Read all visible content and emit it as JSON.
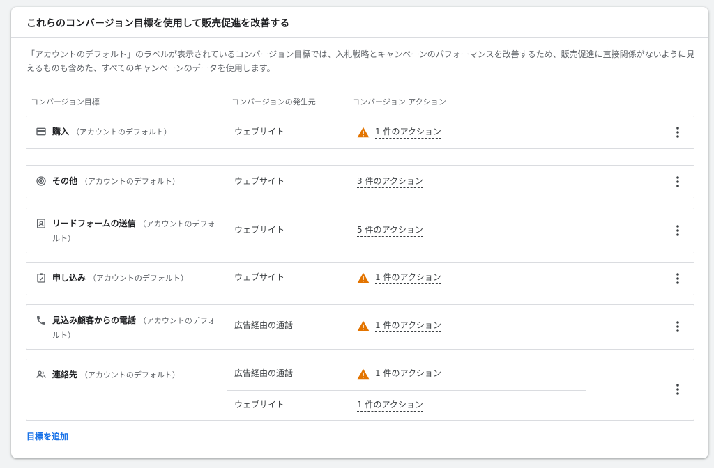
{
  "header": {
    "title": "これらのコンバージョン目標を使用して販売促進を改善する"
  },
  "description": "「アカウントのデフォルト」のラベルが表示されているコンバージョン目標では、入札戦略とキャンペーンのパフォーマンスを改善するため、販売促進に直接関係がないように見えるものも含めた、すべてのキャンペーンのデータを使用します。",
  "columns": {
    "goal": "コンバージョン目標",
    "source": "コンバージョンの発生元",
    "action": "コンバージョン アクション"
  },
  "rows": [
    {
      "icon": "credit-card-icon",
      "name": "購入",
      "default_label": "（アカウントのデフォルト）",
      "sources": [
        {
          "source": "ウェブサイト",
          "action": "1 件のアクション",
          "warning": true
        }
      ]
    },
    {
      "icon": "target-icon",
      "name": "その他",
      "default_label": "（アカウントのデフォルト）",
      "sources": [
        {
          "source": "ウェブサイト",
          "action": "3 件のアクション",
          "warning": false
        }
      ]
    },
    {
      "icon": "contact-form-icon",
      "name": "リードフォームの送信",
      "default_label": "（アカウントのデフォルト）",
      "sources": [
        {
          "source": "ウェブサイト",
          "action": "5 件のアクション",
          "warning": false
        }
      ]
    },
    {
      "icon": "clipboard-check-icon",
      "name": "申し込み",
      "default_label": "（アカウントのデフォルト）",
      "sources": [
        {
          "source": "ウェブサイト",
          "action": "1 件のアクション",
          "warning": true
        }
      ]
    },
    {
      "icon": "phone-icon",
      "name": "見込み顧客からの電話",
      "default_label": "（アカウントのデフォルト）",
      "sources": [
        {
          "source": "広告経由の通話",
          "action": "1 件のアクション",
          "warning": true
        }
      ]
    },
    {
      "icon": "people-icon",
      "name": "連絡先",
      "default_label": "（アカウントのデフォルト）",
      "sources": [
        {
          "source": "広告経由の通話",
          "action": "1 件のアクション",
          "warning": true
        },
        {
          "source": "ウェブサイト",
          "action": "1 件のアクション",
          "warning": false
        }
      ]
    }
  ],
  "add_goal_label": "目標を追加",
  "colors": {
    "accent": "#1a73e8",
    "warning": "#e37400",
    "border": "#dadce0",
    "text": "#3c4043"
  }
}
